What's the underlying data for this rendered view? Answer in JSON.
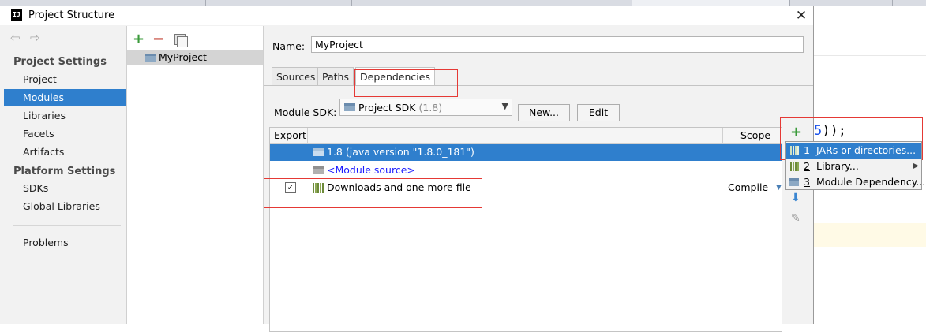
{
  "window": {
    "title": "Project Structure",
    "app_icon": "IJ"
  },
  "nav": {
    "project_settings_header": "Project Settings",
    "project_settings_items": [
      {
        "label": "Project"
      },
      {
        "label": "Modules",
        "selected": true
      },
      {
        "label": "Libraries"
      },
      {
        "label": "Facets"
      },
      {
        "label": "Artifacts"
      }
    ],
    "platform_settings_header": "Platform Settings",
    "platform_settings_items": [
      {
        "label": "SDKs"
      },
      {
        "label": "Global Libraries"
      }
    ],
    "problems": "Problems"
  },
  "modules": {
    "items": [
      "MyProject"
    ]
  },
  "main": {
    "name_label": "Name:",
    "name_value": "MyProject",
    "tabs": [
      {
        "label": "Sources"
      },
      {
        "label": "Paths"
      },
      {
        "label": "Dependencies",
        "active": true
      }
    ],
    "sdk_label": "Module SDK:",
    "sdk_value": "Project SDK",
    "sdk_version": "(1.8)",
    "new_button": "New...",
    "edit_button": "Edit",
    "table": {
      "headers": {
        "export": "Export",
        "scope": "Scope"
      },
      "rows": [
        {
          "label": "1.8 (java version \"1.8.0_181\")",
          "selected": true
        },
        {
          "label": "<Module source>"
        },
        {
          "label": "Downloads and one more file",
          "scope": "Compile",
          "checked": true
        }
      ]
    }
  },
  "add_menu": {
    "items": [
      {
        "number": "1",
        "label": "JARs or directories...",
        "selected": true
      },
      {
        "number": "2",
        "label": "Library...",
        "has_submenu": true
      },
      {
        "number": "3",
        "label": "Module Dependency..."
      }
    ]
  },
  "editor": {
    "code_number": "5",
    "code_rest": "));"
  },
  "colors": {
    "selection": "#2f7fcd",
    "highlight_box": "#e53935",
    "add_green": "#3a9a3a",
    "remove_red": "#c0392b"
  }
}
